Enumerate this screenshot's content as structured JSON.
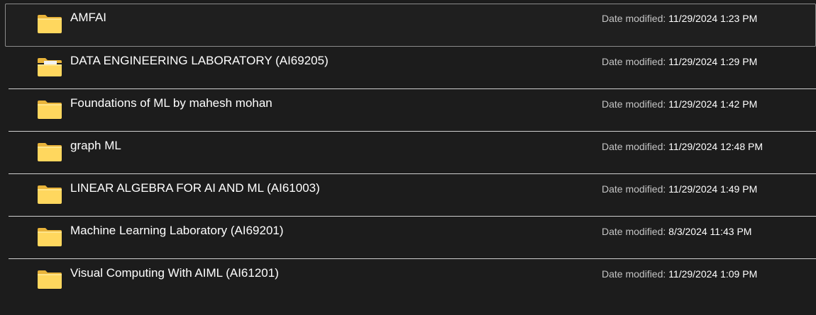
{
  "date_label": "Date modified:",
  "folders": [
    {
      "name": "AMFAI",
      "date_modified": "11/29/2024 1:23 PM",
      "icon": "folder-icon",
      "has_contents_preview": false
    },
    {
      "name": "DATA ENGINEERING LABORATORY (AI69205)",
      "date_modified": "11/29/2024 1:29 PM",
      "icon": "folder-icon",
      "has_contents_preview": true
    },
    {
      "name": "Foundations of ML by mahesh mohan",
      "date_modified": "11/29/2024 1:42 PM",
      "icon": "folder-icon",
      "has_contents_preview": false
    },
    {
      "name": "graph ML",
      "date_modified": "11/29/2024 12:48 PM",
      "icon": "folder-icon",
      "has_contents_preview": false
    },
    {
      "name": "LINEAR ALGEBRA FOR AI AND ML (AI61003)",
      "date_modified": "11/29/2024 1:49 PM",
      "icon": "folder-icon",
      "has_contents_preview": false
    },
    {
      "name": "Machine Learning Laboratory (AI69201)",
      "date_modified": "8/3/2024 11:43 PM",
      "icon": "folder-icon",
      "has_contents_preview": false
    },
    {
      "name": "Visual Computing With AIML (AI61201)",
      "date_modified": "11/29/2024 1:09 PM",
      "icon": "folder-icon",
      "has_contents_preview": false
    }
  ],
  "colors": {
    "background": "#1c1c1c",
    "folder_front": "#ffd75e",
    "folder_back": "#e8b33a",
    "separator": "#cfcfcf"
  }
}
